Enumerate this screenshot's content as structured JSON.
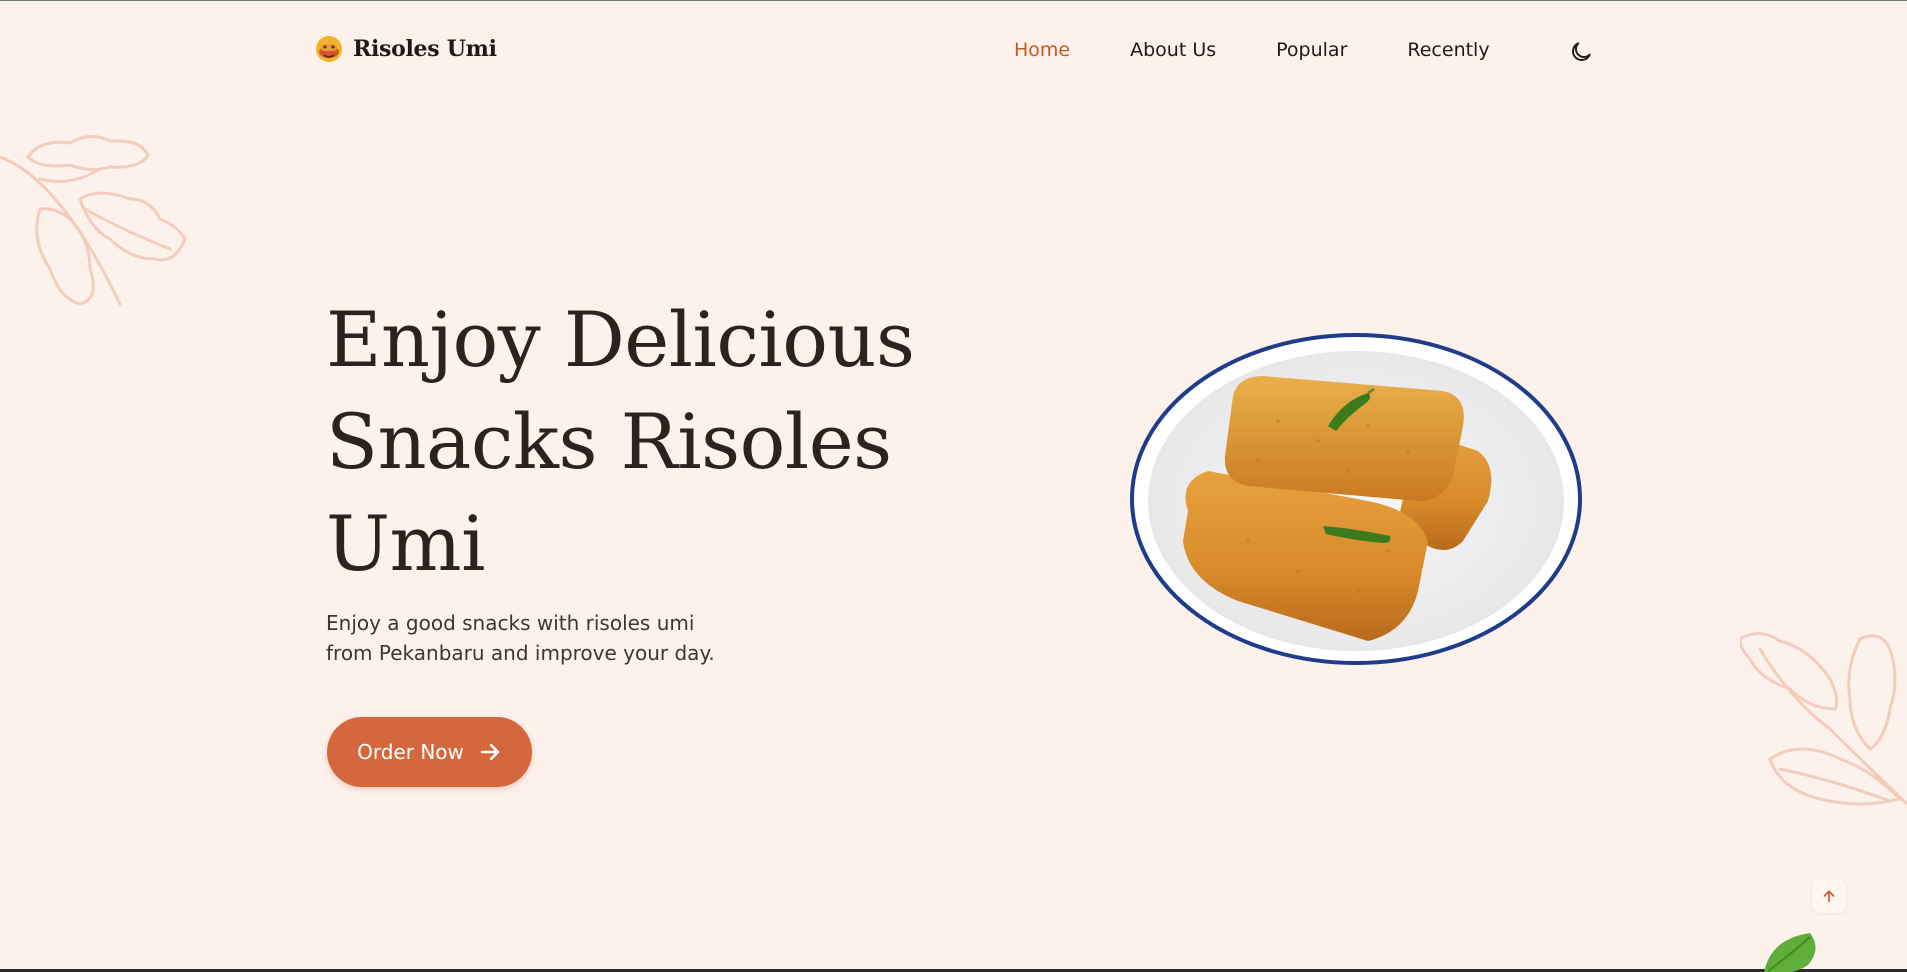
{
  "brand": {
    "name": "Risoles Umi",
    "icon": "risoles-logo-icon"
  },
  "nav": {
    "items": [
      {
        "label": "Home",
        "active": true
      },
      {
        "label": "About Us",
        "active": false
      },
      {
        "label": "Popular",
        "active": false
      },
      {
        "label": "Recently",
        "active": false
      }
    ],
    "theme_toggle_icon": "moon-icon"
  },
  "hero": {
    "title": "Enjoy Delicious Snacks Risoles Umi",
    "description": "Enjoy a good snacks with risoles umi from Pekanbaru and improve your day.",
    "cta_label": "Order Now",
    "cta_icon": "arrow-right-icon",
    "image": "risoles-plate-image"
  },
  "scroll_up_icon": "arrow-up-icon",
  "colors": {
    "background": "#fdf1ec",
    "accent": "#d4683c",
    "active_nav": "#c25a22",
    "text": "#2a2320",
    "leaf_outline": "#f2cdbd"
  }
}
